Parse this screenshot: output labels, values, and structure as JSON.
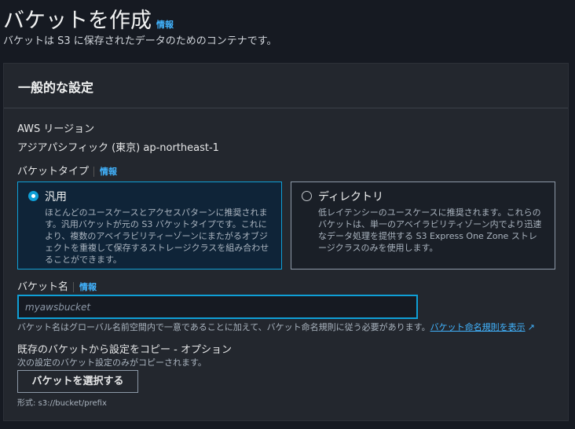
{
  "header": {
    "title": "バケットを作成",
    "info": "情報",
    "subtitle": "バケットは S3 に保存されたデータのためのコンテナです。"
  },
  "section": {
    "title": "一般的な設定",
    "region_label": "AWS リージョン",
    "region_value": "アジアパシフィック (東京) ap-northeast-1",
    "bucket_type_label": "バケットタイプ",
    "bucket_type_info": "情報",
    "options": [
      {
        "title": "汎用",
        "desc": "ほとんどのユースケースとアクセスパターンに推奨されます。汎用バケットが元の S3 バケットタイプです。これにより、複数のアベイラビリティーゾーンにまたがるオブジェクトを重複して保存するストレージクラスを組み合わせることができます。",
        "selected": true
      },
      {
        "title": "ディレクトリ",
        "desc": "低レイテンシーのユースケースに推奨されます。これらのバケットは、単一のアベイラビリティゾーン内でより迅速なデータ処理を提供する S3 Express One Zone ストレージクラスのみを使用します。",
        "selected": false
      }
    ],
    "bucket_name_label": "バケット名",
    "bucket_name_info": "情報",
    "bucket_name_placeholder": "myawsbucket",
    "bucket_name_value": "",
    "bucket_name_hint": "バケット名はグローバル名前空間内で一意であることに加えて、バケット命名規則に従う必要があります。",
    "naming_rules_link": "バケット命名規則を表示",
    "copy_label": "既存のバケットから設定をコピー - オプション",
    "copy_desc": "次の設定のバケット設定のみがコピーされます。",
    "choose_bucket_button": "バケットを選択する",
    "format_hint": "形式: s3://bucket/prefix"
  }
}
